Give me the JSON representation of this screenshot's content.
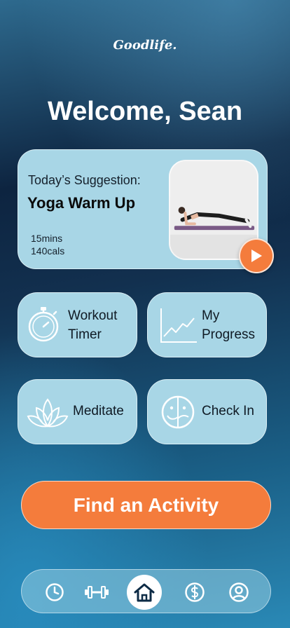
{
  "app": {
    "logo_text": "Goodlife."
  },
  "header": {
    "welcome": "Welcome, Sean"
  },
  "suggestion": {
    "label": "Today’s Suggestion:",
    "title": "Yoga Warm Up",
    "duration": "15mins",
    "calories": "140cals",
    "photo_icon": "plank-exercise-photo",
    "play_icon": "play-icon"
  },
  "tiles": {
    "workout_timer": {
      "line1": "Workout",
      "line2": "Timer",
      "icon": "stopwatch-icon"
    },
    "my_progress": {
      "line1": "My",
      "line2": "Progress",
      "icon": "line-chart-icon"
    },
    "meditate": {
      "label": "Meditate",
      "icon": "lotus-icon"
    },
    "check_in": {
      "label": "Check In",
      "icon": "mood-face-icon"
    }
  },
  "cta": {
    "label": "Find an Activity"
  },
  "nav": {
    "items": [
      {
        "name": "history",
        "icon": "clock-icon"
      },
      {
        "name": "workouts",
        "icon": "dumbbell-icon"
      },
      {
        "name": "home",
        "icon": "home-icon",
        "active": true
      },
      {
        "name": "billing",
        "icon": "dollar-icon"
      },
      {
        "name": "profile",
        "icon": "user-icon"
      }
    ]
  },
  "colors": {
    "accent": "#f47c3c",
    "card": "#a8d6e6",
    "text_dark": "#0f1a24"
  }
}
